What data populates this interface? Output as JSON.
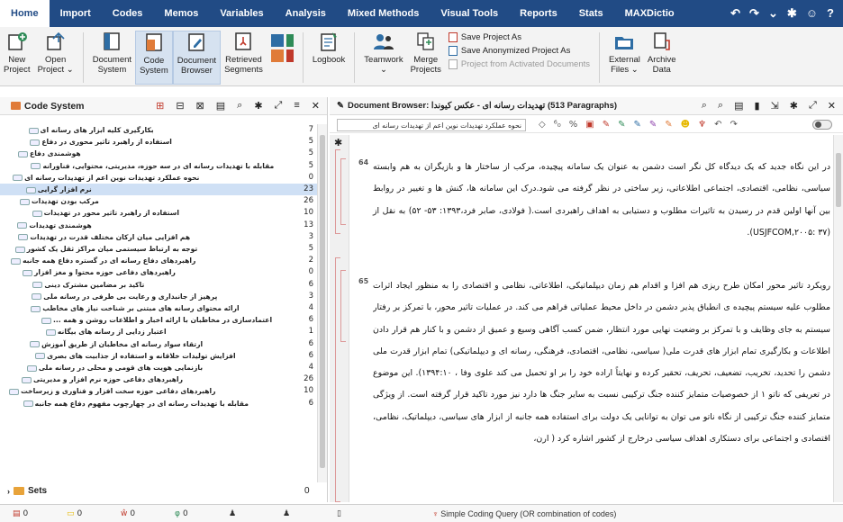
{
  "menu": {
    "items": [
      "Home",
      "Import",
      "Codes",
      "Memos",
      "Variables",
      "Analysis",
      "Mixed Methods",
      "Visual Tools",
      "Reports",
      "Stats",
      "MAXDictio"
    ],
    "active": "Home",
    "right_icons": [
      "↶",
      "↷",
      "⌄",
      "✱",
      "☺",
      "?"
    ]
  },
  "ribbon": {
    "new_project": [
      "New",
      "Project"
    ],
    "open_project": [
      "Open",
      "Project ⌄"
    ],
    "document_system": [
      "Document",
      "System"
    ],
    "code_system": [
      "Code",
      "System"
    ],
    "document_browser": [
      "Document",
      "Browser"
    ],
    "retrieved_segments": [
      "Retrieved",
      "Segments"
    ],
    "logbook": [
      "Logbook"
    ],
    "teamwork": [
      "Teamwork"
    ],
    "merge_projects": [
      "Merge",
      "Projects"
    ],
    "save_project_as": "Save Project As",
    "save_anonymized": "Save Anonymized Project As",
    "project_from_activated": "Project from Activated Documents",
    "external_files": [
      "External",
      "Files ⌄"
    ],
    "archive_data": [
      "Archive",
      "Data"
    ]
  },
  "code_system": {
    "title": "Code System",
    "tools": [
      "⊞",
      "⊟",
      "⊠",
      "▤",
      "⌕",
      "✱",
      "⤢",
      "≡",
      "✕"
    ],
    "rows": [
      {
        "label": "بکارگیری کلیه ابزار های رسانه ای",
        "count": "7",
        "indent": 1
      },
      {
        "label": "استفاده از راهبرد تاثیر محوری در دفاع",
        "count": "5",
        "indent": 1
      },
      {
        "label": "هوشمندی دفاع",
        "count": "5",
        "indent": 1
      },
      {
        "label": "مقابله با تهدیدات رسانه ای در سه حوزه، مدیریتی، محتوایی، فناورانه",
        "count": "5",
        "indent": 1
      },
      {
        "label": "نحوه عملکرد تهدیدات نوین اعم از تهدیدات رسانه ای",
        "count": "0",
        "indent": 0
      },
      {
        "label": "نرم افزار گرایی",
        "count": "23",
        "indent": 1,
        "selected": true
      },
      {
        "label": "مرکب بودن تهدیدات",
        "count": "26",
        "indent": 1
      },
      {
        "label": "استفاده از راهبرد تاثیر محور در تهدیدات",
        "count": "10",
        "indent": 1
      },
      {
        "label": "هوشمندی تهدیدات",
        "count": "13",
        "indent": 1
      },
      {
        "label": "هم افزایی میان ارکان مختلف قدرت در تهدیدات",
        "count": "3",
        "indent": 1
      },
      {
        "label": "توجه به ارتباط سیستمی میان مراکز ثقل یک کشور",
        "count": "5",
        "indent": 1
      },
      {
        "label": "راهبردهای دفاع رسانه ای در گستره دفاع همه جانبه",
        "count": "2",
        "indent": 0
      },
      {
        "label": "راهبردهای دفاعی حوزه محتوا و مغز افزار",
        "count": "0",
        "indent": 1
      },
      {
        "label": "تاکید بر مضامین مشترک دینی",
        "count": "6",
        "indent": 2
      },
      {
        "label": "پرهیز از جانبداری و رعایت بی طرفی در رسانه ملی",
        "count": "3",
        "indent": 2
      },
      {
        "label": "ارائه محتوای رسانه های مبتنی بر شناخت نیاز های مخاطب",
        "count": "4",
        "indent": 2
      },
      {
        "label": "اعتمادسازی در مخاطبان با ارائه اخبار و اطلاعات روشن و همه ...",
        "count": "6",
        "indent": 2
      },
      {
        "label": "اعتبار زدایی از رسانه های بیگانه",
        "count": "1",
        "indent": 2
      },
      {
        "label": "ارتقاء سواد رسانه ای مخاطبان از طریق آموزش",
        "count": "6",
        "indent": 2
      },
      {
        "label": "افزایش تولیدات خلاقانه و استفاده از جذابیت های بصری",
        "count": "6",
        "indent": 2
      },
      {
        "label": "بازنمایی هویت های قومی و محلی در رسانه ملی",
        "count": "4",
        "indent": 2
      },
      {
        "label": "راهبردهای دفاعی حوزه نرم افزار و مدیریتی",
        "count": "26",
        "indent": 1
      },
      {
        "label": "راهبردهای دفاعی حوزه سخت افزار و فناوری و زیرساخت",
        "count": "10",
        "indent": 1
      },
      {
        "label": "مقابله با تهدیدات رسانه ای در چهارچوب مفهوم دفاع همه جانبه",
        "count": "6",
        "indent": 1
      }
    ],
    "sets_label": "Sets",
    "sets_count": "0"
  },
  "document_browser": {
    "title": "Document Browser: تهدیدات رسانه ای - عکس کیوندا (513 Paragraphs)",
    "code_select": "نحوه عملکرد تهدیدات نوین اعم از تهدیدات رسانه ای",
    "paragraphs": [
      {
        "num": "64",
        "text": "در این نگاه جدید که یک دیدگاه کل نگر است دشمن به عنوان یک سامانه پیچیده، مرکب از ساختار ها و بازیگران به هم وابسته سیاسی، نظامی، اقتصادی، اجتماعی اطلاعاتی، زیر ساختی در نظر گرفته می شود.درک این سامانه ها، کنش ها و تغییر در روابط بین آنها اولین قدم در رسیدن به تاثیرات مطلوب و دستیابی به اهداف راهبردی است.( فولادی، صابر فرد،۱۳۹۳: ۵۳- ۵۲) به نقل از (USJFCOM,۲۰۰۵: ۳۷)."
      },
      {
        "num": "65",
        "text": "رویکرد تاثیر محور امکان طرح ریزی هم افزا و اقدام هم زمان دیپلماتیکی، اطلاعاتی، نظامی و اقتصادی را به منظور ایجاد اثرات مطلوب علیه سیستم پیچیده ی انطباق پذیر دشمن در داخل محیط عملیاتی فراهم می کند. در عملیات تاثیر محور، با تمرکز بر رفتار سیستم به جای وظایف و با تمرکز بر وضعیت نهایی مورد انتظار، ضمن کسب آگاهی وسیع و عمیق از دشمن و با کنار هم قرار دادن اطلاعات و بکارگیری تمام ابزار های قدرت ملی( سیاسی، نظامی، اقتصادی، فرهنگی، رسانه ای و دیپلماتیکی) تمام ابزار قدرت ملی دشمن را تحدید، تخریب، تضعیف، تحریف، تحقیر کرده و نهایتاً اراده خود را بر او تحمیل می کند علوی وفا ، ۱۳۹۴:۱۰). این موضوع در تعریفی که ناتو ۱ از خصوصیات متمایز کننده جنگ ترکیبی نسبت به سایر جنگ ها دارد نیز مورد تاکید قرار گرفته است. از ویژگی متمایز کننده جنگ ترکیبی از نگاه ناتو می توان به توانایی یک دولت برای استفاده همه جانبه از ابزار های سیاسی، دیپلماتیک، نظامی، اقتصادی و اجتماعی برای دستکاری اهداف سیاسی درخارج از کشور اشاره کرد ( ارن،"
      }
    ]
  },
  "status": {
    "items": [
      {
        "icon": "doc",
        "value": "0"
      },
      {
        "icon": "code",
        "value": "0"
      },
      {
        "icon": "memo",
        "value": "0"
      },
      {
        "icon": "link",
        "value": "0"
      },
      {
        "icon": "user",
        "value": ""
      },
      {
        "icon": "users",
        "value": ""
      },
      {
        "icon": "page",
        "value": ""
      }
    ],
    "query": "Simple Coding Query (OR combination of codes)"
  },
  "colors": {
    "menubar": "#214b85",
    "accent": "#c0392b"
  }
}
